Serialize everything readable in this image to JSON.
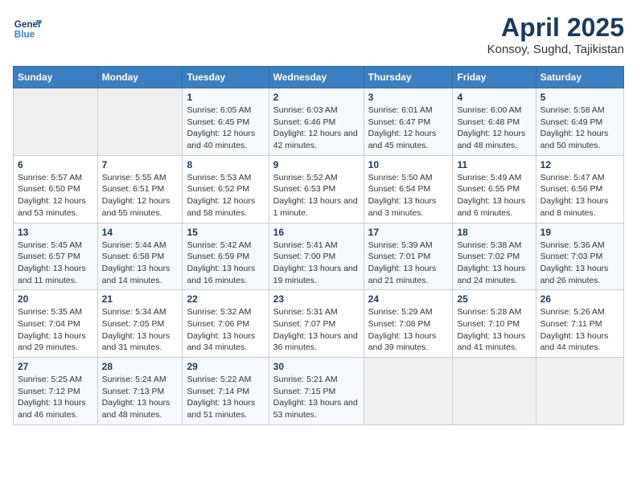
{
  "header": {
    "logo_line1": "General",
    "logo_line2": "Blue",
    "month_year": "April 2025",
    "location": "Konsoy, Sughd, Tajikistan"
  },
  "weekdays": [
    "Sunday",
    "Monday",
    "Tuesday",
    "Wednesday",
    "Thursday",
    "Friday",
    "Saturday"
  ],
  "weeks": [
    [
      {
        "day": null
      },
      {
        "day": null
      },
      {
        "day": "1",
        "sunrise": "Sunrise: 6:05 AM",
        "sunset": "Sunset: 6:45 PM",
        "daylight": "Daylight: 12 hours and 40 minutes."
      },
      {
        "day": "2",
        "sunrise": "Sunrise: 6:03 AM",
        "sunset": "Sunset: 6:46 PM",
        "daylight": "Daylight: 12 hours and 42 minutes."
      },
      {
        "day": "3",
        "sunrise": "Sunrise: 6:01 AM",
        "sunset": "Sunset: 6:47 PM",
        "daylight": "Daylight: 12 hours and 45 minutes."
      },
      {
        "day": "4",
        "sunrise": "Sunrise: 6:00 AM",
        "sunset": "Sunset: 6:48 PM",
        "daylight": "Daylight: 12 hours and 48 minutes."
      },
      {
        "day": "5",
        "sunrise": "Sunrise: 5:58 AM",
        "sunset": "Sunset: 6:49 PM",
        "daylight": "Daylight: 12 hours and 50 minutes."
      }
    ],
    [
      {
        "day": "6",
        "sunrise": "Sunrise: 5:57 AM",
        "sunset": "Sunset: 6:50 PM",
        "daylight": "Daylight: 12 hours and 53 minutes."
      },
      {
        "day": "7",
        "sunrise": "Sunrise: 5:55 AM",
        "sunset": "Sunset: 6:51 PM",
        "daylight": "Daylight: 12 hours and 55 minutes."
      },
      {
        "day": "8",
        "sunrise": "Sunrise: 5:53 AM",
        "sunset": "Sunset: 6:52 PM",
        "daylight": "Daylight: 12 hours and 58 minutes."
      },
      {
        "day": "9",
        "sunrise": "Sunrise: 5:52 AM",
        "sunset": "Sunset: 6:53 PM",
        "daylight": "Daylight: 13 hours and 1 minute."
      },
      {
        "day": "10",
        "sunrise": "Sunrise: 5:50 AM",
        "sunset": "Sunset: 6:54 PM",
        "daylight": "Daylight: 13 hours and 3 minutes."
      },
      {
        "day": "11",
        "sunrise": "Sunrise: 5:49 AM",
        "sunset": "Sunset: 6:55 PM",
        "daylight": "Daylight: 13 hours and 6 minutes."
      },
      {
        "day": "12",
        "sunrise": "Sunrise: 5:47 AM",
        "sunset": "Sunset: 6:56 PM",
        "daylight": "Daylight: 13 hours and 8 minutes."
      }
    ],
    [
      {
        "day": "13",
        "sunrise": "Sunrise: 5:45 AM",
        "sunset": "Sunset: 6:57 PM",
        "daylight": "Daylight: 13 hours and 11 minutes."
      },
      {
        "day": "14",
        "sunrise": "Sunrise: 5:44 AM",
        "sunset": "Sunset: 6:58 PM",
        "daylight": "Daylight: 13 hours and 14 minutes."
      },
      {
        "day": "15",
        "sunrise": "Sunrise: 5:42 AM",
        "sunset": "Sunset: 6:59 PM",
        "daylight": "Daylight: 13 hours and 16 minutes."
      },
      {
        "day": "16",
        "sunrise": "Sunrise: 5:41 AM",
        "sunset": "Sunset: 7:00 PM",
        "daylight": "Daylight: 13 hours and 19 minutes."
      },
      {
        "day": "17",
        "sunrise": "Sunrise: 5:39 AM",
        "sunset": "Sunset: 7:01 PM",
        "daylight": "Daylight: 13 hours and 21 minutes."
      },
      {
        "day": "18",
        "sunrise": "Sunrise: 5:38 AM",
        "sunset": "Sunset: 7:02 PM",
        "daylight": "Daylight: 13 hours and 24 minutes."
      },
      {
        "day": "19",
        "sunrise": "Sunrise: 5:36 AM",
        "sunset": "Sunset: 7:03 PM",
        "daylight": "Daylight: 13 hours and 26 minutes."
      }
    ],
    [
      {
        "day": "20",
        "sunrise": "Sunrise: 5:35 AM",
        "sunset": "Sunset: 7:04 PM",
        "daylight": "Daylight: 13 hours and 29 minutes."
      },
      {
        "day": "21",
        "sunrise": "Sunrise: 5:34 AM",
        "sunset": "Sunset: 7:05 PM",
        "daylight": "Daylight: 13 hours and 31 minutes."
      },
      {
        "day": "22",
        "sunrise": "Sunrise: 5:32 AM",
        "sunset": "Sunset: 7:06 PM",
        "daylight": "Daylight: 13 hours and 34 minutes."
      },
      {
        "day": "23",
        "sunrise": "Sunrise: 5:31 AM",
        "sunset": "Sunset: 7:07 PM",
        "daylight": "Daylight: 13 hours and 36 minutes."
      },
      {
        "day": "24",
        "sunrise": "Sunrise: 5:29 AM",
        "sunset": "Sunset: 7:08 PM",
        "daylight": "Daylight: 13 hours and 39 minutes."
      },
      {
        "day": "25",
        "sunrise": "Sunrise: 5:28 AM",
        "sunset": "Sunset: 7:10 PM",
        "daylight": "Daylight: 13 hours and 41 minutes."
      },
      {
        "day": "26",
        "sunrise": "Sunrise: 5:26 AM",
        "sunset": "Sunset: 7:11 PM",
        "daylight": "Daylight: 13 hours and 44 minutes."
      }
    ],
    [
      {
        "day": "27",
        "sunrise": "Sunrise: 5:25 AM",
        "sunset": "Sunset: 7:12 PM",
        "daylight": "Daylight: 13 hours and 46 minutes."
      },
      {
        "day": "28",
        "sunrise": "Sunrise: 5:24 AM",
        "sunset": "Sunset: 7:13 PM",
        "daylight": "Daylight: 13 hours and 48 minutes."
      },
      {
        "day": "29",
        "sunrise": "Sunrise: 5:22 AM",
        "sunset": "Sunset: 7:14 PM",
        "daylight": "Daylight: 13 hours and 51 minutes."
      },
      {
        "day": "30",
        "sunrise": "Sunrise: 5:21 AM",
        "sunset": "Sunset: 7:15 PM",
        "daylight": "Daylight: 13 hours and 53 minutes."
      },
      {
        "day": null
      },
      {
        "day": null
      },
      {
        "day": null
      }
    ]
  ]
}
